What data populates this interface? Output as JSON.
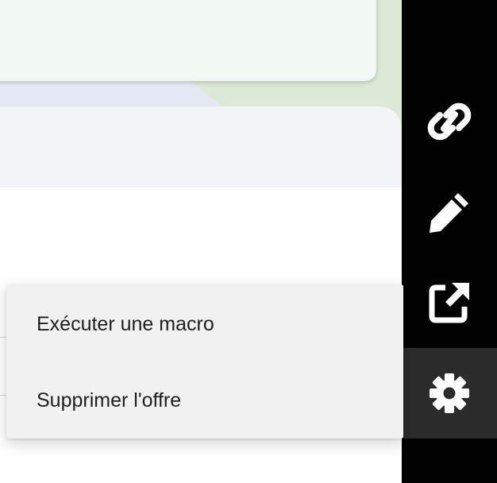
{
  "toolbar": {
    "buttons": [
      {
        "icon": "link-icon"
      },
      {
        "icon": "pencil-icon"
      },
      {
        "icon": "external-link-icon"
      },
      {
        "icon": "gear-icon",
        "active": true
      }
    ]
  },
  "context_menu": {
    "items": [
      {
        "label": "Exécuter une macro"
      },
      {
        "label": "Supprimer l'offre"
      }
    ]
  },
  "colors": {
    "toolbar_bg": "#000000",
    "toolbar_active": "#2b2b2b",
    "menu_bg": "#f1f1f1",
    "card_bg": "#f2f8f3"
  }
}
